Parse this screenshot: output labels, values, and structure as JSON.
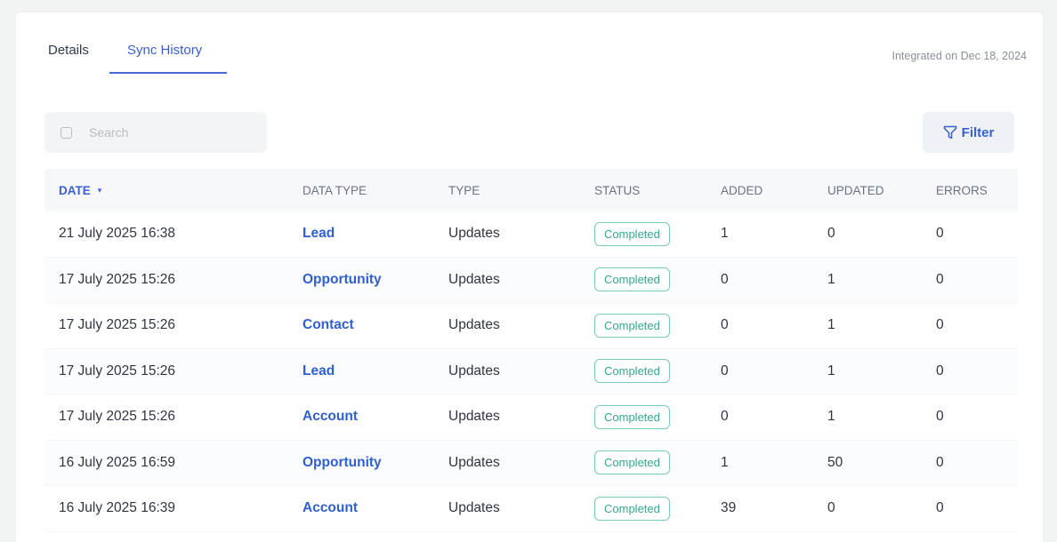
{
  "tabs": [
    {
      "label": "Details"
    },
    {
      "label": "Sync History"
    }
  ],
  "integrated_text": "Integrated on Dec 18, 2024",
  "search": {
    "placeholder": "Search"
  },
  "filter_label": "Filter",
  "colors": {
    "accent": "#3a5fcf",
    "badge_border": "#78c9b8",
    "badge_text": "#3aa58e"
  },
  "table": {
    "headers": {
      "date": "DATE",
      "data_type": "DATA TYPE",
      "type": "TYPE",
      "status": "STATUS",
      "added": "ADDED",
      "updated": "UPDATED",
      "errors": "ERRORS"
    },
    "rows": [
      {
        "date": "21 July 2025 16:38",
        "data_type": "Lead",
        "type": "Updates",
        "status": "Completed",
        "added": "1",
        "updated": "0",
        "errors": "0"
      },
      {
        "date": "17 July 2025 15:26",
        "data_type": "Opportunity",
        "type": "Updates",
        "status": "Completed",
        "added": "0",
        "updated": "1",
        "errors": "0"
      },
      {
        "date": "17 July 2025 15:26",
        "data_type": "Contact",
        "type": "Updates",
        "status": "Completed",
        "added": "0",
        "updated": "1",
        "errors": "0"
      },
      {
        "date": "17 July 2025 15:26",
        "data_type": "Lead",
        "type": "Updates",
        "status": "Completed",
        "added": "0",
        "updated": "1",
        "errors": "0"
      },
      {
        "date": "17 July 2025 15:26",
        "data_type": "Account",
        "type": "Updates",
        "status": "Completed",
        "added": "0",
        "updated": "1",
        "errors": "0"
      },
      {
        "date": "16 July 2025 16:59",
        "data_type": "Opportunity",
        "type": "Updates",
        "status": "Completed",
        "added": "1",
        "updated": "50",
        "errors": "0"
      },
      {
        "date": "16 July 2025 16:39",
        "data_type": "Account",
        "type": "Updates",
        "status": "Completed",
        "added": "39",
        "updated": "0",
        "errors": "0"
      }
    ]
  }
}
